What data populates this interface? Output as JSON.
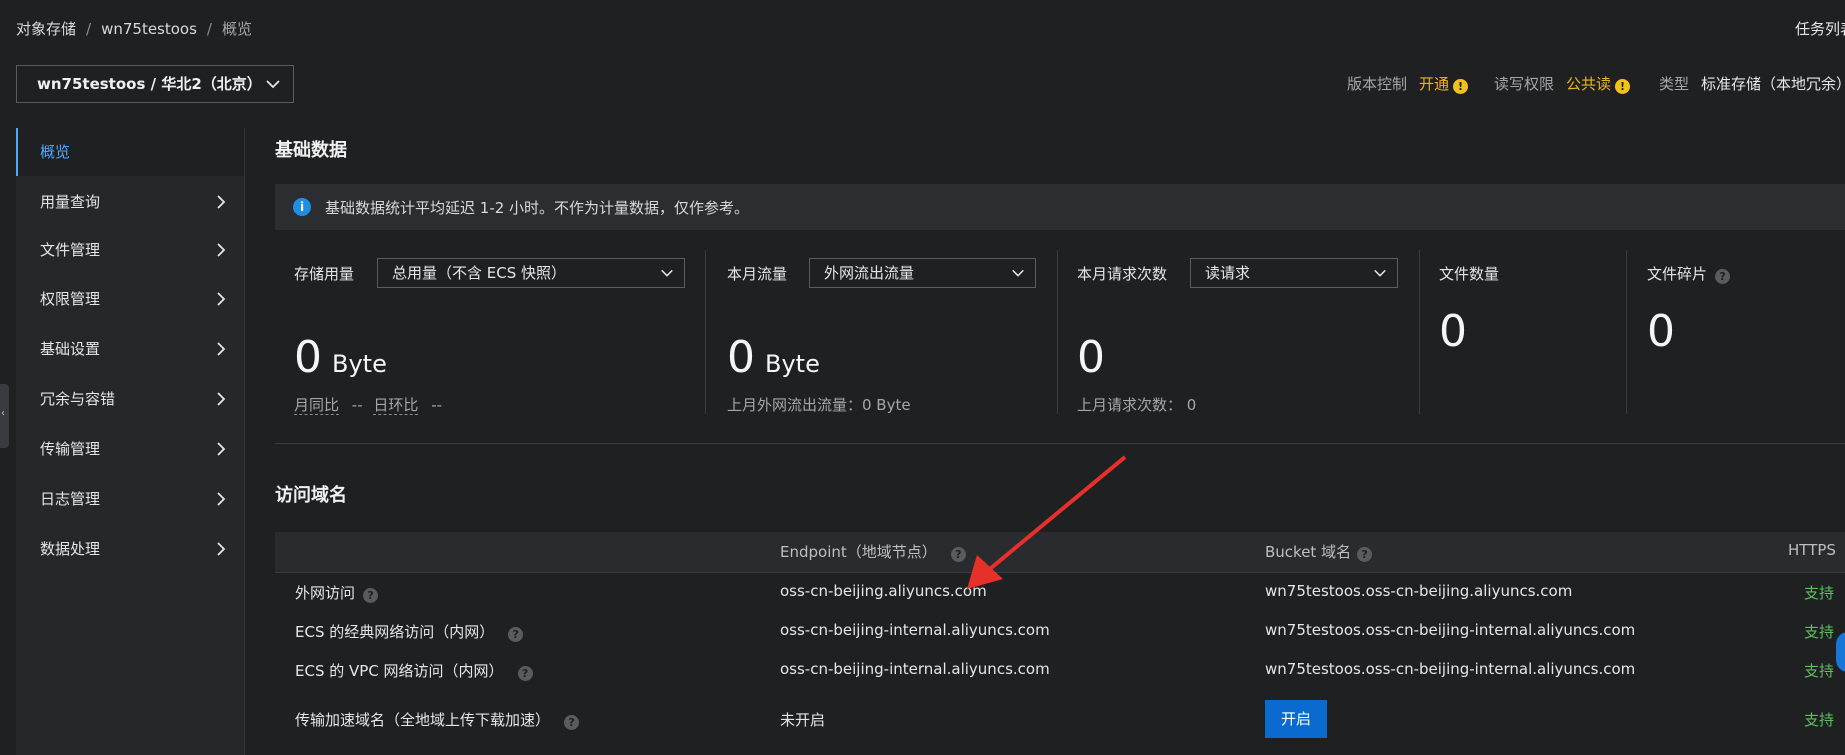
{
  "header": {
    "breadcrumb": [
      "对象存储",
      "wn75testoos",
      "概览"
    ],
    "task_list_label": "任务列表",
    "bucket_selector": "wn75testoos / 华北2（北京）",
    "meta": {
      "version_label": "版本控制",
      "version_value": "开通",
      "acl_label": "读写权限",
      "acl_value": "公共读",
      "type_label": "类型",
      "type_value": "标准存储（本地冗余）"
    }
  },
  "sidebar": {
    "items": [
      {
        "label": "概览",
        "active": true,
        "has_arrow": false
      },
      {
        "label": "用量查询",
        "active": false,
        "has_arrow": true
      },
      {
        "label": "文件管理",
        "active": false,
        "has_arrow": true
      },
      {
        "label": "权限管理",
        "active": false,
        "has_arrow": true
      },
      {
        "label": "基础设置",
        "active": false,
        "has_arrow": true
      },
      {
        "label": "冗余与容错",
        "active": false,
        "has_arrow": true
      },
      {
        "label": "传输管理",
        "active": false,
        "has_arrow": true
      },
      {
        "label": "日志管理",
        "active": false,
        "has_arrow": true
      },
      {
        "label": "数据处理",
        "active": false,
        "has_arrow": true
      }
    ]
  },
  "basic_data": {
    "title": "基础数据",
    "notice": "基础数据统计平均延迟 1-2 小时。不作为计量数据，仅作参考。",
    "storage": {
      "label": "存储用量",
      "select": "总用量（不含 ECS 快照）",
      "value": "0",
      "unit": "Byte",
      "mom_label": "月同比",
      "mom_value": "--",
      "dod_label": "日环比",
      "dod_value": "--"
    },
    "traffic": {
      "label": "本月流量",
      "select": "外网流出流量",
      "value": "0",
      "unit": "Byte",
      "last_month": "上月外网流出流量：0 Byte"
    },
    "requests": {
      "label": "本月请求次数",
      "select": "读请求",
      "value": "0",
      "last_month": "上月请求次数：  0"
    },
    "file_count": {
      "label": "文件数量",
      "value": "0"
    },
    "fragments": {
      "label": "文件碎片",
      "value": "0"
    }
  },
  "access_domains": {
    "title": "访问域名",
    "columns": [
      "",
      "Endpoint（地域节点）",
      "Bucket 域名",
      "HTTPS"
    ],
    "rows": [
      {
        "name": "外网访问",
        "endpoint": "oss-cn-beijing.aliyuncs.com",
        "bucket": "wn75testoos.oss-cn-beijing.aliyuncs.com",
        "https": "支持"
      },
      {
        "name": "ECS 的经典网络访问（内网）",
        "endpoint": "oss-cn-beijing-internal.aliyuncs.com",
        "bucket": "wn75testoos.oss-cn-beijing-internal.aliyuncs.com",
        "https": "支持"
      },
      {
        "name": "ECS 的 VPC 网络访问（内网）",
        "endpoint": "oss-cn-beijing-internal.aliyuncs.com",
        "bucket": "wn75testoos.oss-cn-beijing-internal.aliyuncs.com",
        "https": "支持"
      },
      {
        "name": "传输加速域名（全地域上传下载加速）",
        "endpoint": "未开启",
        "bucket_button": "开启",
        "https": "支持"
      }
    ]
  },
  "colors": {
    "background": "#1f2022",
    "accent": "#4fa8ff",
    "warning": "#e8b521",
    "success": "#5cc05c",
    "primary_button": "#0a6ad0",
    "annotation_arrow": "#e8302a"
  },
  "icons": [
    "chevron-down-icon",
    "chevron-right-icon",
    "info-icon",
    "help-icon",
    "warning-icon",
    "annotation-arrow"
  ]
}
